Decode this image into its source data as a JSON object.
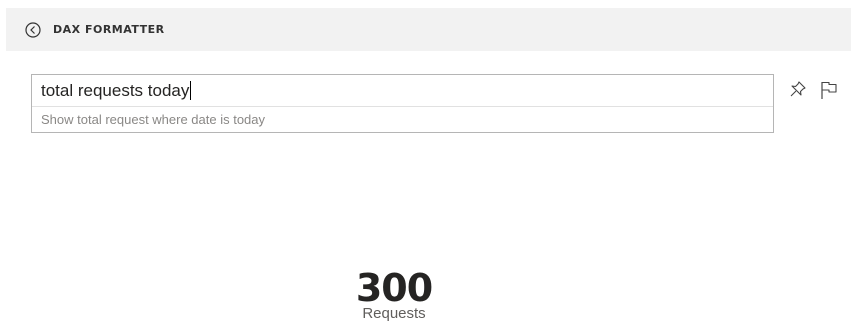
{
  "header": {
    "title": "DAX FORMATTER",
    "back_icon": "back-circle-icon"
  },
  "qa": {
    "query": "total requests today",
    "suggestion": "Show total request where date is today",
    "pin_icon": "pin-icon",
    "flag_icon": "flag-icon"
  },
  "card": {
    "value": "300",
    "label": "Requests"
  },
  "colors": {
    "header_bg": "#f2f2f2",
    "border": "#b5b5b5",
    "text": "#252423",
    "suggestion_text": "#8a8886"
  }
}
